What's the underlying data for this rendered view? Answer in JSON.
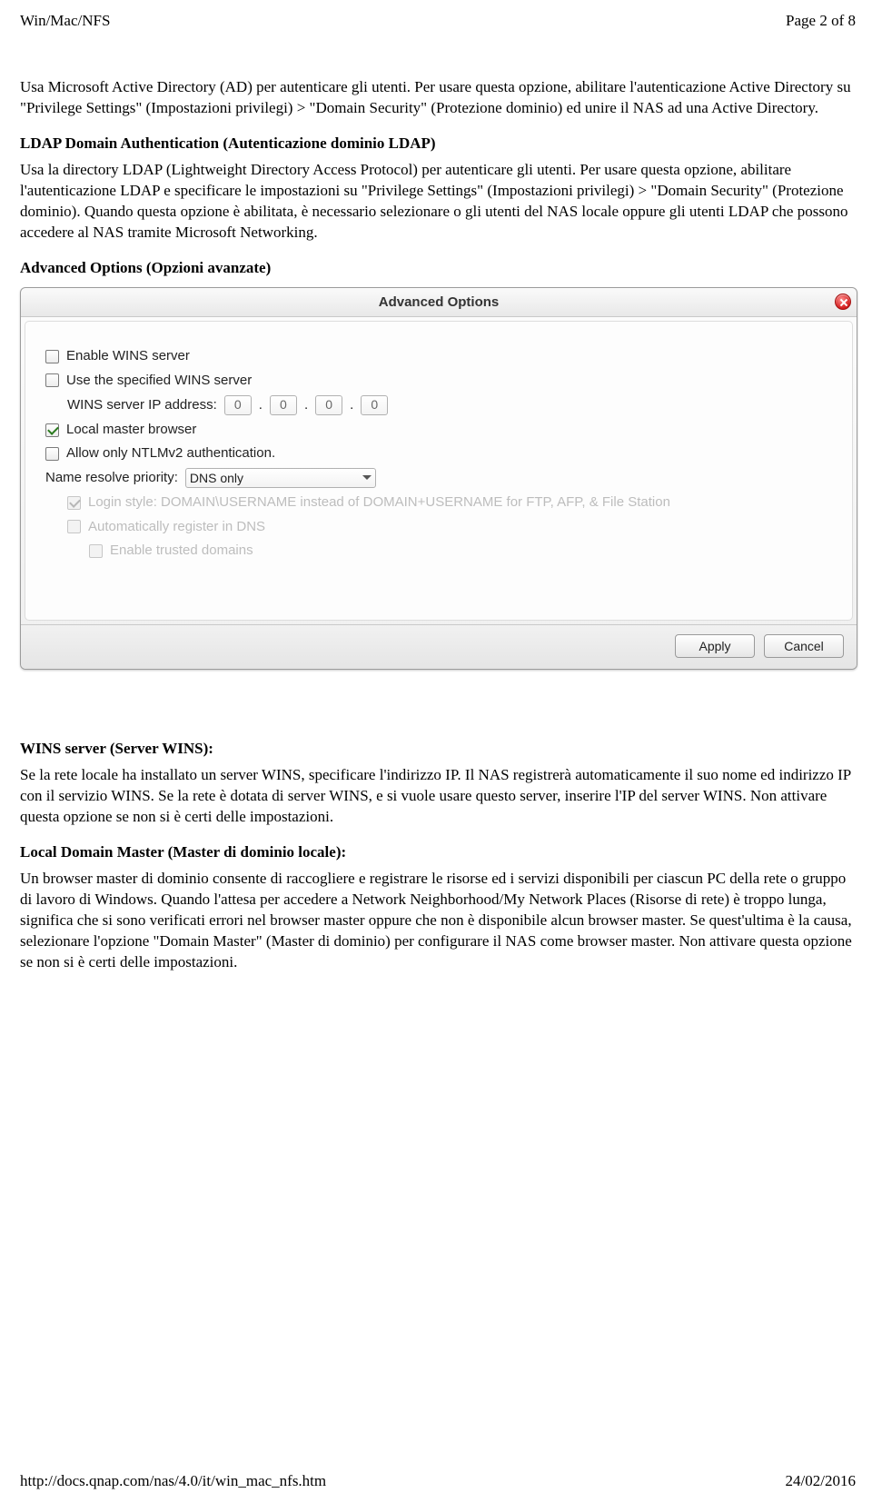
{
  "header": {
    "left": "Win/Mac/NFS",
    "right": "Page 2 of 8"
  },
  "intro": {
    "p1": "Usa Microsoft Active Directory (AD) per autenticare gli utenti. Per usare questa opzione, abilitare l'autenticazione Active Directory su \"Privilege Settings\" (Impostazioni privilegi) > \"Domain Security\" (Protezione dominio) ed unire il NAS ad una Active Directory."
  },
  "ldap": {
    "title": "LDAP Domain Authentication (Autenticazione dominio LDAP)",
    "body": "Usa la directory LDAP (Lightweight Directory Access Protocol) per autenticare gli utenti. Per usare questa opzione, abilitare l'autenticazione LDAP e specificare le impostazioni su \"Privilege Settings\" (Impostazioni privilegi) > \"Domain Security\" (Protezione dominio). Quando questa opzione è abilitata, è necessario selezionare o gli utenti del NAS locale oppure gli utenti LDAP che possono accedere al NAS tramite Microsoft Networking."
  },
  "adv": {
    "heading": "Advanced Options (Opzioni avanzate)",
    "dialog_title": "Advanced Options",
    "enable_wins": "Enable WINS server",
    "use_wins": "Use the specified WINS server",
    "wins_ip_label": "WINS server IP address:",
    "ip": [
      "0",
      "0",
      "0",
      "0"
    ],
    "local_master": "Local master browser",
    "ntlmv2": "Allow only NTLMv2 authentication.",
    "resolve_label": "Name resolve priority:",
    "resolve_value": "DNS only",
    "login_style": "Login style: DOMAIN\\USERNAME instead of DOMAIN+USERNAME for FTP, AFP, & File Station",
    "auto_dns": "Automatically register in DNS",
    "trusted": "Enable trusted domains",
    "apply": "Apply",
    "cancel": "Cancel"
  },
  "wins": {
    "title": "WINS server (Server WINS):",
    "body": "Se la rete locale ha installato un server WINS, specificare l'indirizzo IP. Il NAS registrerà automaticamente il suo nome ed indirizzo IP con il servizio WINS. Se la rete è dotata di server WINS, e si vuole usare questo server, inserire l'IP del server WINS. Non attivare questa opzione se non si è certi delle impostazioni."
  },
  "ldm": {
    "title": "Local Domain Master (Master di dominio locale):",
    "body": "Un browser master di dominio consente di raccogliere e registrare le risorse ed i servizi disponibili per ciascun PC della rete o gruppo di lavoro di Windows. Quando l'attesa per accedere a Network Neighborhood/My Network Places (Risorse di rete) è troppo lunga, significa che si sono verificati errori nel browser master oppure che non è disponibile alcun browser master. Se quest'ultima è la causa, selezionare l'opzione \"Domain Master\" (Master di dominio) per configurare il NAS come browser master. Non attivare questa opzione se non si è certi delle impostazioni."
  },
  "footer": {
    "left": "http://docs.qnap.com/nas/4.0/it/win_mac_nfs.htm",
    "right": "24/02/2016"
  }
}
